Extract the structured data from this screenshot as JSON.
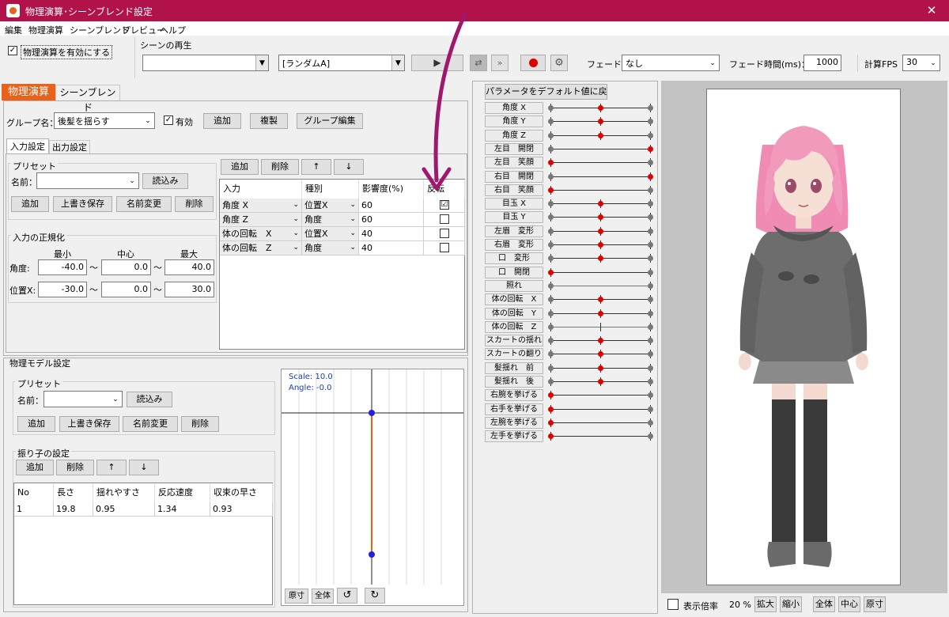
{
  "window": {
    "title": "物理演算･シーンブレンド設定",
    "close": "✕"
  },
  "menu": [
    "編集",
    "物理演算",
    "シーンブレンド",
    "プレビュー",
    "ヘルプ"
  ],
  "toolbar": {
    "enable_physics_label": "物理演算を有効にする",
    "scene_play_label": "シーンの再生",
    "scene_select_value": "",
    "random_select_value": "[ランダムA]",
    "fade_label": "フェード：",
    "fade_value": "なし",
    "fade_time_label": "フェード時間(ms)：",
    "fade_time_value": "1000",
    "fps_label": "計算FPS",
    "fps_value": "30",
    "icons": [
      "play-icon",
      "loop-icon",
      "skip-icon",
      "record-icon",
      "gear-icon"
    ]
  },
  "left_tabs": [
    "物理演算",
    "シーンブレンド"
  ],
  "group": {
    "name_label": "グループ名：",
    "name_value": "後髪を揺らす",
    "enabled_label": "有効",
    "add": "追加",
    "duplicate": "複製",
    "group_edit": "グループ編集"
  },
  "sub_tabs": [
    "入力設定",
    "出力設定"
  ],
  "input_preset": {
    "title": "プリセット",
    "name_label": "名前：",
    "load": "読込み",
    "add": "追加",
    "overwrite": "上書き保存",
    "rename": "名前変更",
    "delete": "削除"
  },
  "normalize": {
    "title": "入力の正規化",
    "headers": [
      "最小",
      "中心",
      "最大"
    ],
    "tilde": "～",
    "rows": [
      {
        "label": "角度:",
        "min": "-40.0",
        "center": "0.0",
        "max": "40.0"
      },
      {
        "label": "位置X:",
        "min": "-30.0",
        "center": "0.0",
        "max": "30.0"
      }
    ]
  },
  "input_list": {
    "buttons": [
      "追加",
      "削除",
      "↑",
      "↓"
    ],
    "headers": [
      "入力",
      "種別",
      "影響度(%)",
      "反転"
    ],
    "rows": [
      {
        "input": "角度 X",
        "type": "位置X",
        "influence": "60",
        "invert": "☑"
      },
      {
        "input": "角度 Z",
        "type": "角度",
        "influence": "60",
        "invert": ""
      },
      {
        "input": "体の回転　X",
        "type": "位置X",
        "influence": "40",
        "invert": ""
      },
      {
        "input": "体の回転　Z",
        "type": "角度",
        "influence": "40",
        "invert": ""
      }
    ]
  },
  "model": {
    "title": "物理モデル設定",
    "preset_title": "プリセット",
    "name_label": "名前：",
    "load": "読込み",
    "add": "追加",
    "overwrite": "上書き保存",
    "rename": "名前変更",
    "delete": "削除",
    "pendulum_title": "振り子の設定",
    "pendulum_buttons": [
      "追加",
      "削除",
      "↑",
      "↓"
    ],
    "headers": [
      "No",
      "長さ",
      "揺れやすさ",
      "反応速度",
      "収束の早さ"
    ],
    "rows": [
      {
        "no": "1",
        "length": "19.8",
        "ease": "0.95",
        "speed": "1.34",
        "convergence": "0.93"
      }
    ]
  },
  "graph": {
    "scale": "Scale: 10.0",
    "angle": "Angle: -0.0",
    "buttons": [
      "原寸",
      "全体"
    ],
    "icons": [
      "rotate-left-icon",
      "rotate-right-icon"
    ]
  },
  "params": {
    "reset_button": "パラメータをデフォルト値に戻す",
    "items": [
      {
        "label": "角度 X",
        "level": 0.5,
        "active": true,
        "center_tick": true
      },
      {
        "label": "角度 Y",
        "level": 0.5,
        "active": true,
        "center_tick": true
      },
      {
        "label": "角度 Z",
        "level": 0.5,
        "active": true,
        "center_tick": true
      },
      {
        "label": "左目　開閉",
        "level": 1.0,
        "active": true,
        "center_tick": false
      },
      {
        "label": "左目　笑顔",
        "level": 0.0,
        "active": true,
        "center_tick": false
      },
      {
        "label": "右目　開閉",
        "level": 1.0,
        "active": true,
        "center_tick": false
      },
      {
        "label": "右目　笑顔",
        "level": 0.0,
        "active": true,
        "center_tick": false
      },
      {
        "label": "目玉 X",
        "level": 0.5,
        "active": true,
        "center_tick": true
      },
      {
        "label": "目玉 Y",
        "level": 0.5,
        "active": true,
        "center_tick": true
      },
      {
        "label": "左眉　変形",
        "level": 0.5,
        "active": true,
        "center_tick": true
      },
      {
        "label": "右眉　変形",
        "level": 0.5,
        "active": true,
        "center_tick": true
      },
      {
        "label": "口　変形",
        "level": 0.5,
        "active": true,
        "center_tick": true
      },
      {
        "label": "口　開閉",
        "level": 0.0,
        "active": true,
        "center_tick": false
      },
      {
        "label": "照れ",
        "level": 0.0,
        "active": false,
        "center_tick": false
      },
      {
        "label": "体の回転　X",
        "level": 0.5,
        "active": true,
        "center_tick": true
      },
      {
        "label": "体の回転　Y",
        "level": 0.5,
        "active": true,
        "center_tick": true
      },
      {
        "label": "体の回転　Z",
        "level": 0.5,
        "active": false,
        "center_tick": true
      },
      {
        "label": "スカートの揺れ",
        "level": 0.5,
        "active": true,
        "center_tick": true
      },
      {
        "label": "スカートの翻り",
        "level": 0.5,
        "active": true,
        "center_tick": true
      },
      {
        "label": "髪揺れ　前",
        "level": 0.5,
        "active": true,
        "center_tick": true
      },
      {
        "label": "髪揺れ　後",
        "level": 0.5,
        "active": true,
        "center_tick": true
      },
      {
        "label": "右腕を挙げる",
        "level": 0.0,
        "active": true,
        "center_tick": false
      },
      {
        "label": "右手を挙げる",
        "level": 0.0,
        "active": true,
        "center_tick": false
      },
      {
        "label": "左腕を挙げる",
        "level": 0.0,
        "active": true,
        "center_tick": false
      },
      {
        "label": "左手を挙げる",
        "level": 0.0,
        "active": true,
        "center_tick": false
      }
    ]
  },
  "preview": {
    "zoom_label": "表示倍率",
    "zoom_value": "20 %",
    "buttons": [
      "拡大",
      "縮小",
      "全体",
      "中心",
      "原寸"
    ]
  },
  "colors": {
    "title_bar": "#b1124a",
    "active_tab": "#e8621a",
    "annotation_arrow": "#a0186e",
    "knob_active": "#e00000",
    "graph_orange": "#e8621a",
    "graph_point": "#2020e0"
  }
}
